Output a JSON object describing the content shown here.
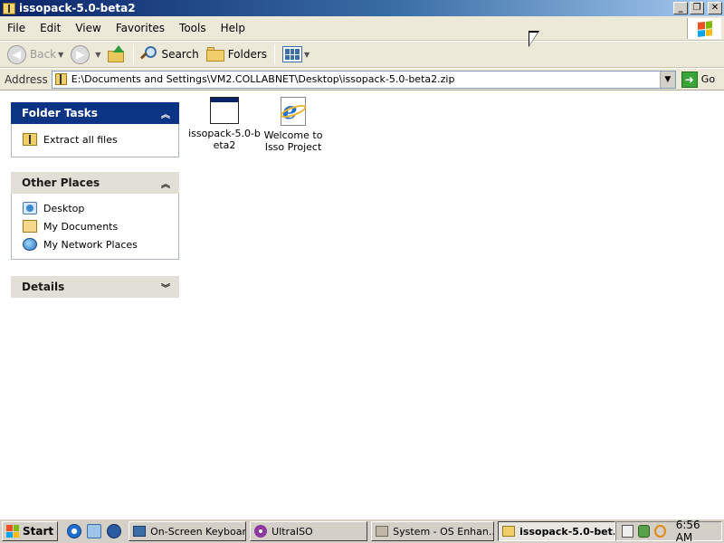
{
  "window": {
    "title": "issopack-5.0-beta2",
    "minimize": "_",
    "restore": "❐",
    "close": "✕"
  },
  "menu": [
    "File",
    "Edit",
    "View",
    "Favorites",
    "Tools",
    "Help"
  ],
  "toolbar": {
    "back": "Back",
    "search": "Search",
    "folders": "Folders"
  },
  "address": {
    "label": "Address",
    "path": "E:\\Documents and Settings\\VM2.COLLABNET\\Desktop\\issopack-5.0-beta2.zip",
    "go": "Go"
  },
  "folder_tasks": {
    "title": "Folder Tasks",
    "items": [
      {
        "label": "Extract all files",
        "icon": "zip-folder-icon"
      }
    ]
  },
  "other_places": {
    "title": "Other Places",
    "items": [
      {
        "label": "Desktop",
        "icon": "desktop-icon"
      },
      {
        "label": "My Documents",
        "icon": "my-documents-icon"
      },
      {
        "label": "My Network Places",
        "icon": "network-places-icon"
      }
    ]
  },
  "details": {
    "title": "Details"
  },
  "files": [
    {
      "line1": "issopack-5.0-b",
      "line2": "eta2",
      "icon": "application-window-icon"
    },
    {
      "line1": "Welcome to",
      "line2": "Isso Project",
      "icon": "internet-explorer-icon"
    }
  ],
  "taskbar": {
    "start": "Start",
    "buttons": [
      {
        "label": "On-Screen Keyboard",
        "active": false
      },
      {
        "label": "UltraISO",
        "active": false
      },
      {
        "label": "System - OS Enhan...",
        "active": false
      },
      {
        "label": "issopack-5.0-bet...",
        "active": true
      }
    ],
    "clock": "6:56 AM"
  }
}
